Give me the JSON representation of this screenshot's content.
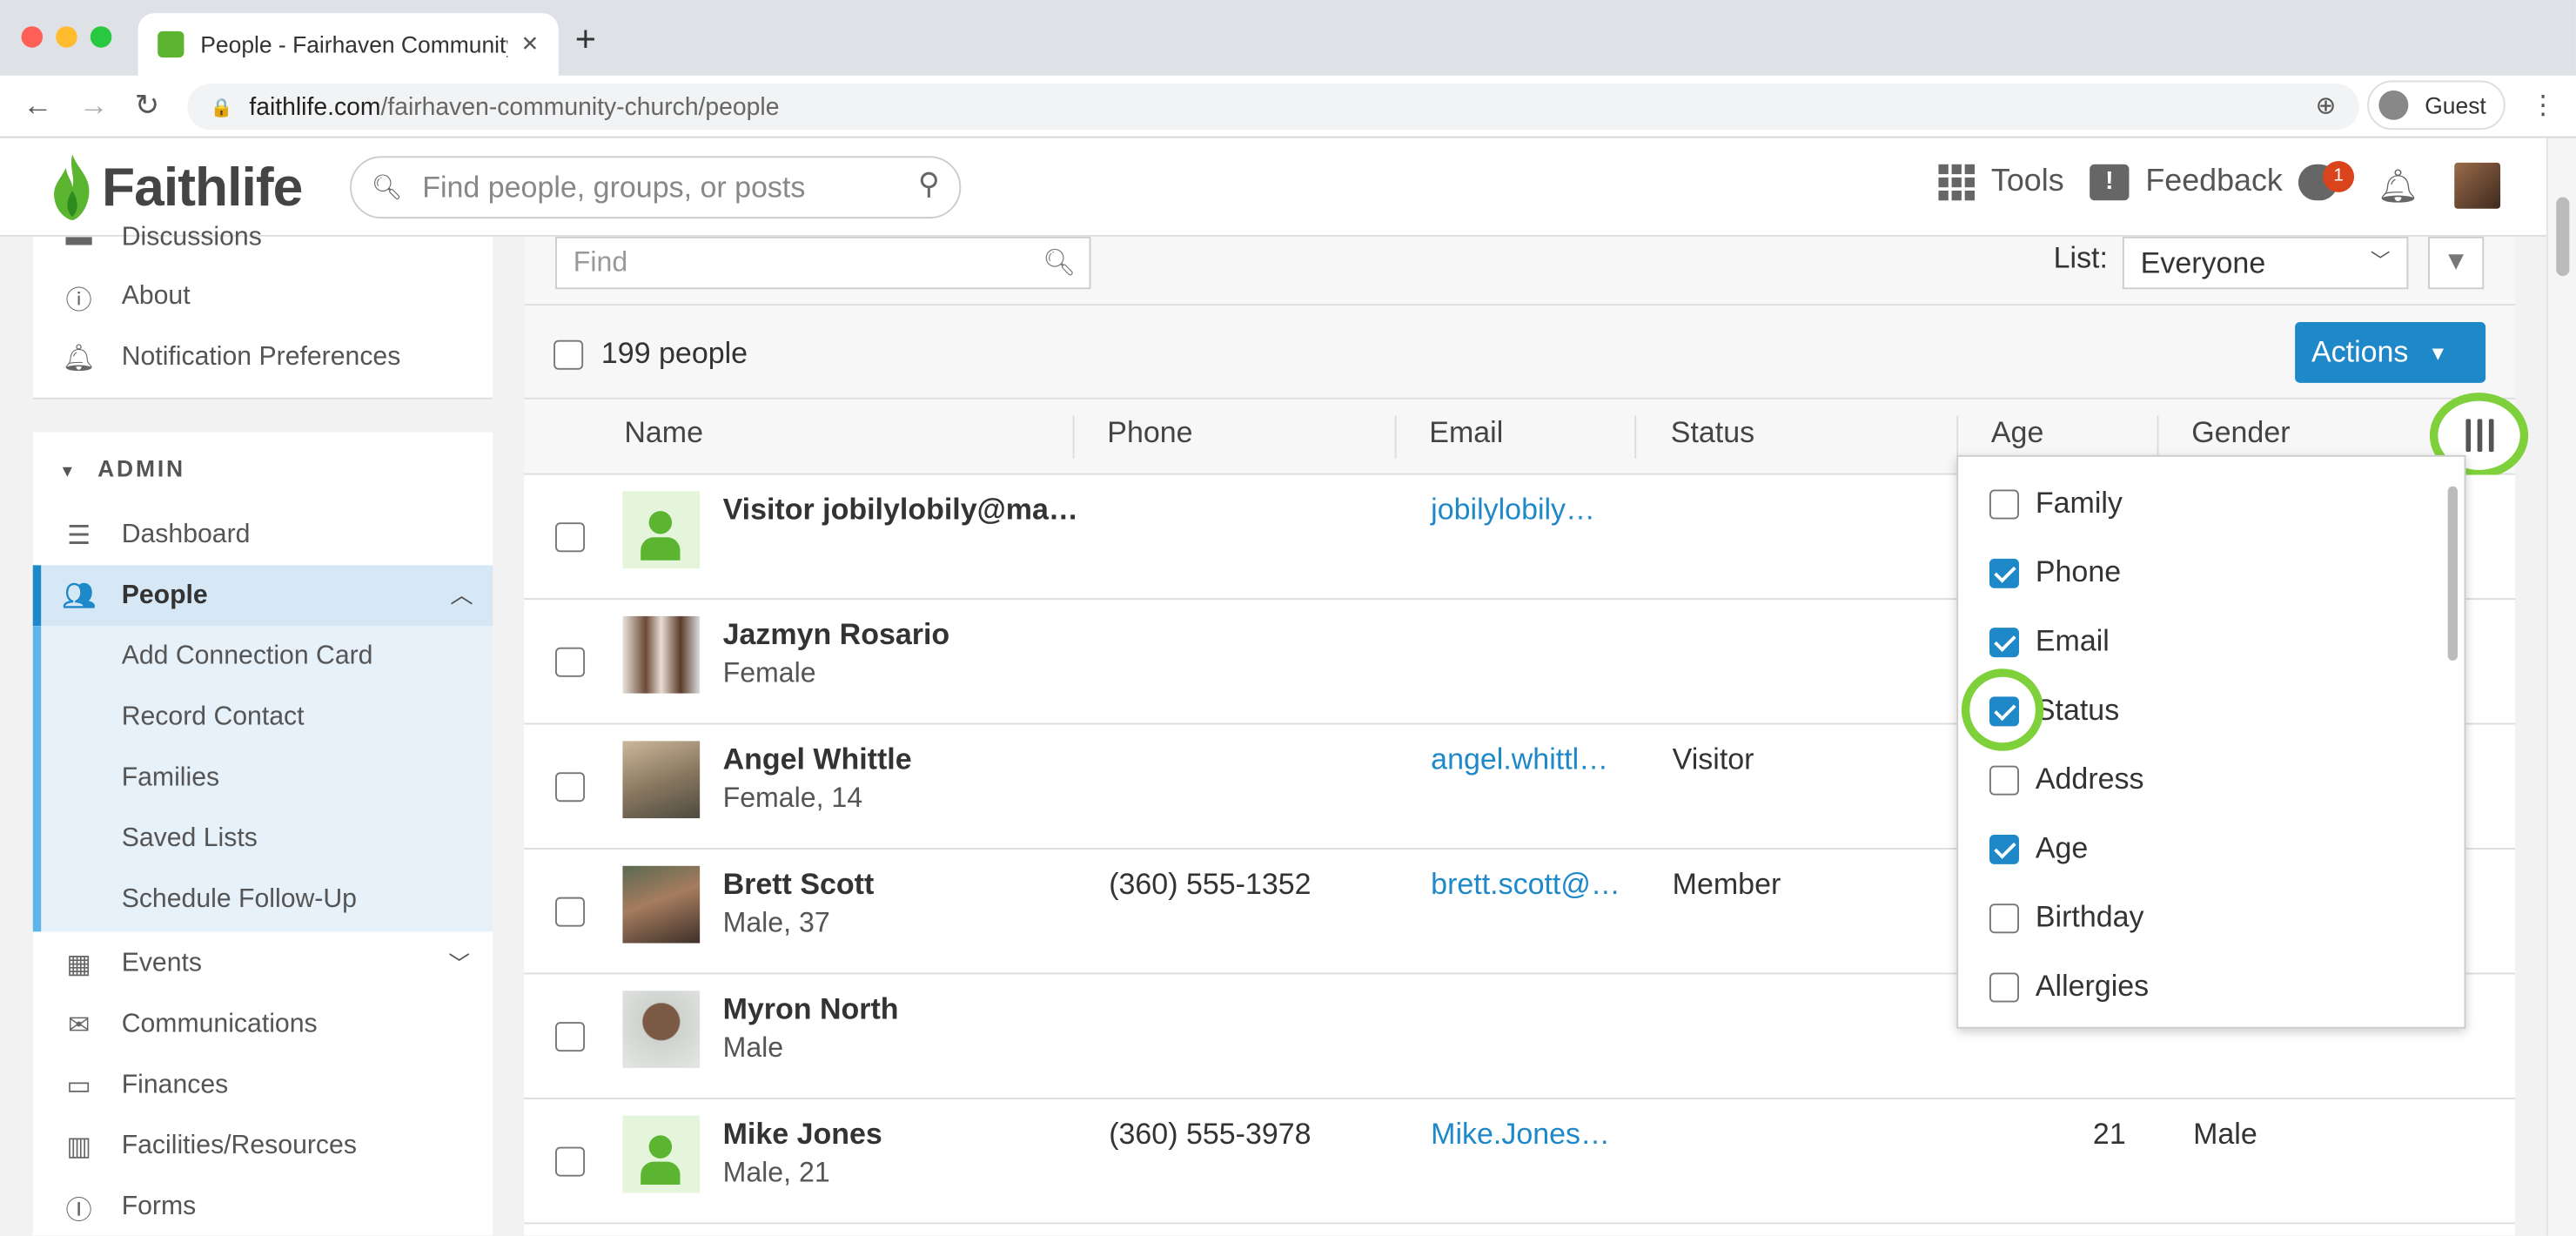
{
  "browser": {
    "tab_title": "People - Fairhaven Community Church",
    "url_host": "faithlife.com",
    "url_path": "/fairhaven-community-church/people",
    "profile_label": "Guest",
    "traffic_colors": {
      "close": "#ff5f57",
      "minimize": "#febc2e",
      "maximize": "#28c840"
    }
  },
  "header": {
    "logo_text": "Faithlife",
    "search_placeholder": "Find people, groups, or posts",
    "tools_label": "Tools",
    "feedback_label": "Feedback",
    "notification_count": "1"
  },
  "sidebar": {
    "top_items": [
      {
        "label": "Discussions",
        "icon": "chat-icon"
      },
      {
        "label": "About",
        "icon": "info-icon"
      },
      {
        "label": "Notification Preferences",
        "icon": "bell-icon"
      }
    ],
    "admin_label": "ADMIN",
    "items": [
      {
        "label": "Dashboard",
        "icon": "dashboard-icon"
      },
      {
        "label": "People",
        "icon": "people-icon"
      },
      {
        "label": "Events",
        "icon": "calendar-icon"
      },
      {
        "label": "Communications",
        "icon": "mail-icon"
      },
      {
        "label": "Finances",
        "icon": "card-icon"
      },
      {
        "label": "Facilities/Resources",
        "icon": "building-icon"
      },
      {
        "label": "Forms",
        "icon": "form-icon"
      }
    ],
    "people_sub": [
      "Add Connection Card",
      "Record Contact",
      "Families",
      "Saved Lists",
      "Schedule Follow-Up"
    ]
  },
  "toolbar": {
    "find_placeholder": "Find",
    "list_label": "List:",
    "list_value": "Everyone",
    "people_count": "199 people",
    "actions_label": "Actions"
  },
  "table": {
    "headers": {
      "name": "Name",
      "phone": "Phone",
      "email": "Email",
      "status": "Status",
      "age": "Age",
      "gender": "Gender"
    },
    "rows": [
      {
        "name": "Visitor jobilylobily@ma…",
        "sub": "",
        "phone": "",
        "email": "jobilylobily…",
        "status": "",
        "age": "",
        "gender": ""
      },
      {
        "name": "Jazmyn Rosario",
        "sub": "Female",
        "phone": "",
        "email": "",
        "status": "",
        "age": "",
        "gender": ""
      },
      {
        "name": "Angel Whittle",
        "sub": "Female, 14",
        "phone": "",
        "email": "angel.whittl…",
        "status": "Visitor",
        "age": "",
        "gender": ""
      },
      {
        "name": "Brett Scott",
        "sub": "Male, 37",
        "phone": "(360) 555-1352",
        "email": "brett.scott@…",
        "status": "Member",
        "age": "",
        "gender": ""
      },
      {
        "name": "Myron North",
        "sub": "Male",
        "phone": "",
        "email": "",
        "status": "",
        "age": "",
        "gender": ""
      },
      {
        "name": "Mike Jones",
        "sub": "Male, 21",
        "phone": "(360) 555-3978",
        "email": "Mike.Jones…",
        "status": "",
        "age": "21",
        "gender": "Male"
      }
    ]
  },
  "columns_menu": {
    "items": [
      {
        "label": "Family",
        "checked": false
      },
      {
        "label": "Phone",
        "checked": true
      },
      {
        "label": "Email",
        "checked": true
      },
      {
        "label": "Status",
        "checked": true
      },
      {
        "label": "Address",
        "checked": false
      },
      {
        "label": "Age",
        "checked": true
      },
      {
        "label": "Birthday",
        "checked": false
      },
      {
        "label": "Allergies",
        "checked": false
      }
    ]
  }
}
